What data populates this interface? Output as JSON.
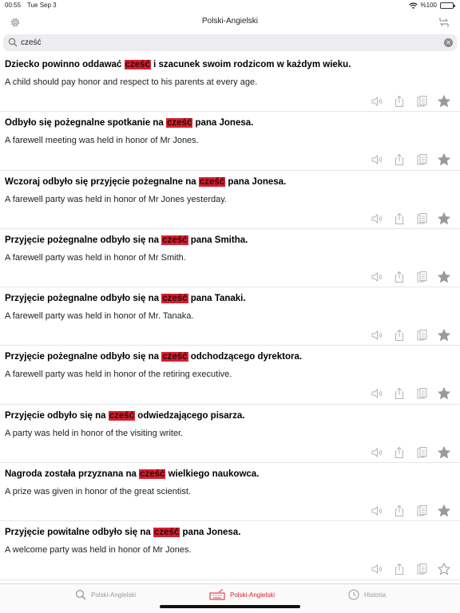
{
  "status": {
    "time": "00:55",
    "date": "Tue Sep 3",
    "battery": "%100"
  },
  "nav": {
    "title": "Polski-Angielski"
  },
  "search": {
    "value": "cześć",
    "placeholder": ""
  },
  "entries": [
    {
      "pl_before": "Dziecko powinno oddawać ",
      "pl_highlight": "cześć",
      "pl_after": " i szacunek swoim rodzicom w każdym wieku.",
      "en": "A child should pay honor and respect to his parents at every age.",
      "favorite": true
    },
    {
      "pl_before": "Odbyło się pożegnalne spotkanie na ",
      "pl_highlight": "cześć",
      "pl_after": " pana Jonesa.",
      "en": "A farewell meeting was held in honor of Mr Jones.",
      "favorite": true
    },
    {
      "pl_before": "Wczoraj odbyło się przyjęcie pożegnalne na ",
      "pl_highlight": "cześć",
      "pl_after": " pana Jonesa.",
      "en": "A farewell party was held in honor of Mr Jones yesterday.",
      "favorite": true
    },
    {
      "pl_before": "Przyjęcie pożegnalne odbyło się na ",
      "pl_highlight": "cześć",
      "pl_after": " pana Smitha.",
      "en": "A farewell party was held in honor of Mr Smith.",
      "favorite": true
    },
    {
      "pl_before": "Przyjęcie pożegnalne odbyło się na ",
      "pl_highlight": "cześć",
      "pl_after": " pana Tanaki.",
      "en": "A farewell party was held in honor of Mr. Tanaka.",
      "favorite": true
    },
    {
      "pl_before": "Przyjęcie pożegnalne odbyło się na ",
      "pl_highlight": "cześć",
      "pl_after": " odchodzącego dyrektora.",
      "en": "A farewell party was held in honor of the retiring executive.",
      "favorite": true
    },
    {
      "pl_before": "Przyjęcie odbyło się na ",
      "pl_highlight": "cześć",
      "pl_after": " odwiedzającego pisarza.",
      "en": "A party was held in honor of the visiting writer.",
      "favorite": true
    },
    {
      "pl_before": "Nagroda została przyznana na ",
      "pl_highlight": "cześć",
      "pl_after": " wielkiego naukowca.",
      "en": "A prize was given in honor of the great scientist.",
      "favorite": true
    },
    {
      "pl_before": "Przyjęcie powitalne odbyło się na ",
      "pl_highlight": "cześć",
      "pl_after": " pana Jonesa.",
      "en": "A welcome party was held in honor of Mr Jones.",
      "favorite": false
    }
  ],
  "tabs": [
    {
      "label": "Polski-Angielski",
      "icon": "search-icon",
      "active": false
    },
    {
      "label": "Polski-Angielski",
      "icon": "keyboard-icon",
      "active": true
    },
    {
      "label": "Historia",
      "icon": "clock-icon",
      "active": false
    }
  ],
  "colors": {
    "accent": "#d81e2f",
    "icon_gray": "#9a9a9a",
    "star_filled": "#9a9a9a"
  }
}
